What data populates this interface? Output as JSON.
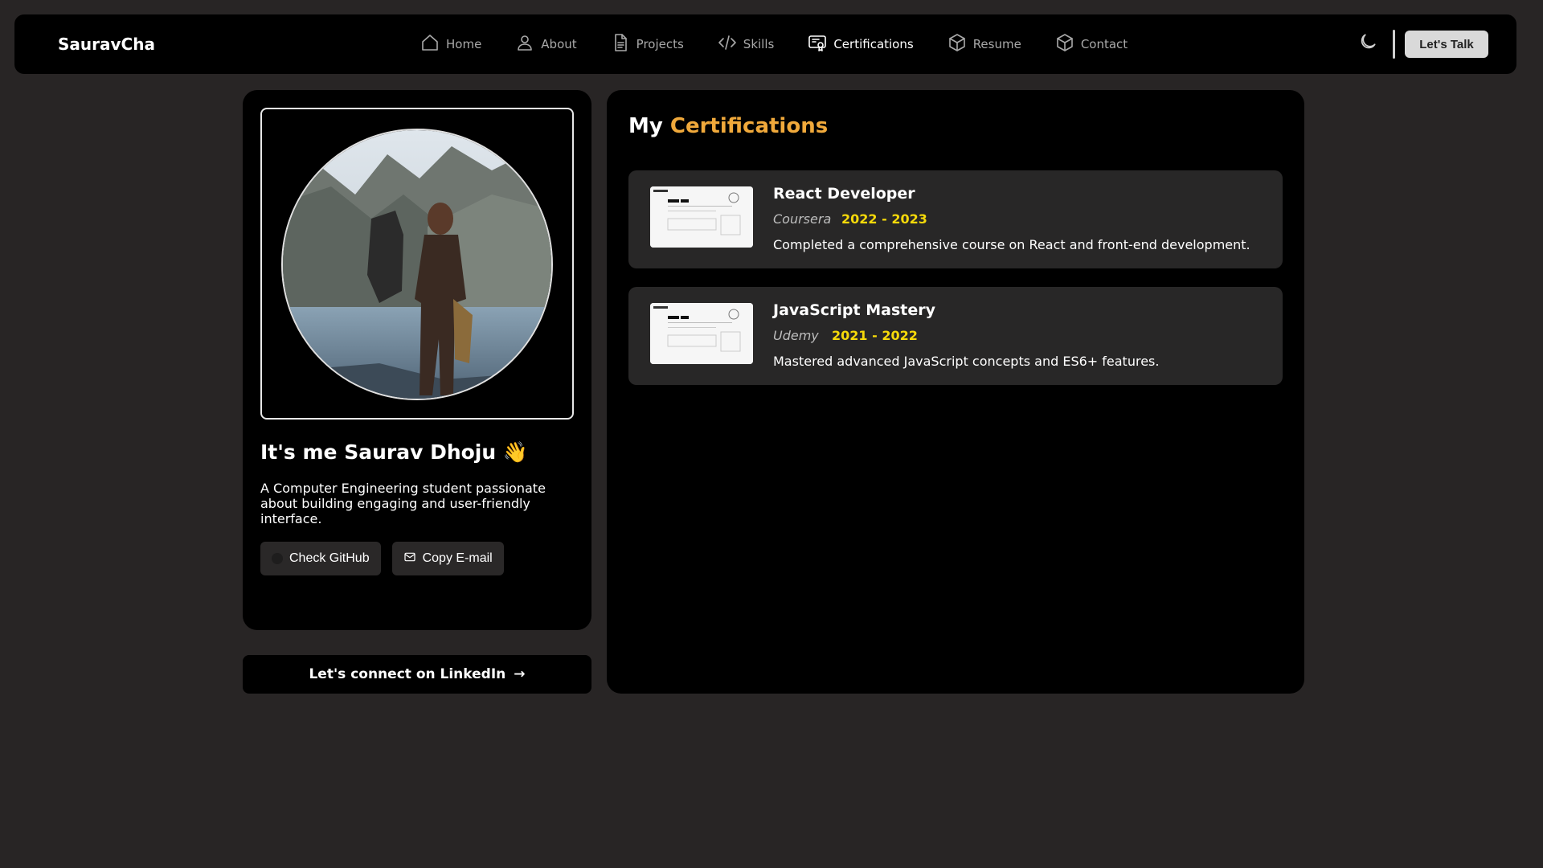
{
  "header": {
    "brand": "SauravCha",
    "nav": [
      {
        "label": "Home",
        "icon": "home-icon",
        "active": false
      },
      {
        "label": "About",
        "icon": "user-icon",
        "active": false
      },
      {
        "label": "Projects",
        "icon": "document-icon",
        "active": false
      },
      {
        "label": "Skills",
        "icon": "code-icon",
        "active": false
      },
      {
        "label": "Certifications",
        "icon": "certificate-icon",
        "active": true
      },
      {
        "label": "Resume",
        "icon": "cube-icon",
        "active": false
      },
      {
        "label": "Contact",
        "icon": "cube-icon",
        "active": false
      }
    ],
    "theme_icon": "moon-icon",
    "cta_label": "Let's Talk"
  },
  "profile": {
    "name": "It's me Saurav Dhoju 👋",
    "bio": "A Computer Engineering student passionate about building engaging and user-friendly interface.",
    "github_label": "Check GitHub",
    "email_label": "Copy E-mail",
    "socials": [
      "github-icon",
      "instagram-icon",
      "linkedin-icon",
      "facebook-icon"
    ],
    "linkedin_cta": "Let's connect on LinkedIn",
    "linkedin_arrow": "→"
  },
  "certifications": {
    "title_prefix": "My",
    "title_accent": "Certifications",
    "items": [
      {
        "name": "React Developer",
        "issuer": "Coursera",
        "years": "2022 - 2023",
        "description": "Completed a comprehensive course on React and front-end development."
      },
      {
        "name": "JavaScript Mastery",
        "issuer": "Udemy",
        "years": "2021 - 2022",
        "description": "Mastered advanced JavaScript concepts and ES6+ features."
      }
    ]
  },
  "colors": {
    "page_bg": "#282525",
    "panel_bg": "#000000",
    "accent": "#f0a93b",
    "year": "#f5d90a"
  }
}
